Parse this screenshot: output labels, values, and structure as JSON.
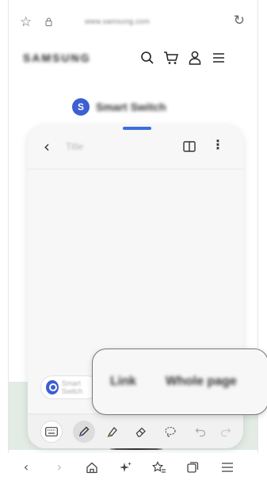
{
  "browser": {
    "url": "www.samsung.com"
  },
  "site": {
    "logo_text": "SAMSUNG",
    "product_badge": "S",
    "product_name": "Smart Switch"
  },
  "notes": {
    "title_placeholder": "Title",
    "chip_label": "Smart Switch"
  },
  "share_popup": {
    "options": [
      "Link",
      "Whole page"
    ]
  },
  "colors": {
    "accent": "#3b6fe0",
    "badge": "#3c5fd1"
  },
  "icons": {
    "urlbar": [
      "star-icon",
      "lock-icon",
      "reload-icon"
    ],
    "header": [
      "search-icon",
      "cart-icon",
      "person-icon",
      "menu-icon"
    ],
    "toolbar": [
      "keyboard-icon",
      "pen-icon",
      "highlighter-icon",
      "eraser-icon",
      "lasso-icon",
      "undo-icon",
      "redo-icon"
    ],
    "bottomnav": [
      "back-icon",
      "forward-icon",
      "home-icon",
      "sparkle-icon",
      "bookmarks-icon",
      "tabs-icon",
      "menu-icon"
    ]
  }
}
